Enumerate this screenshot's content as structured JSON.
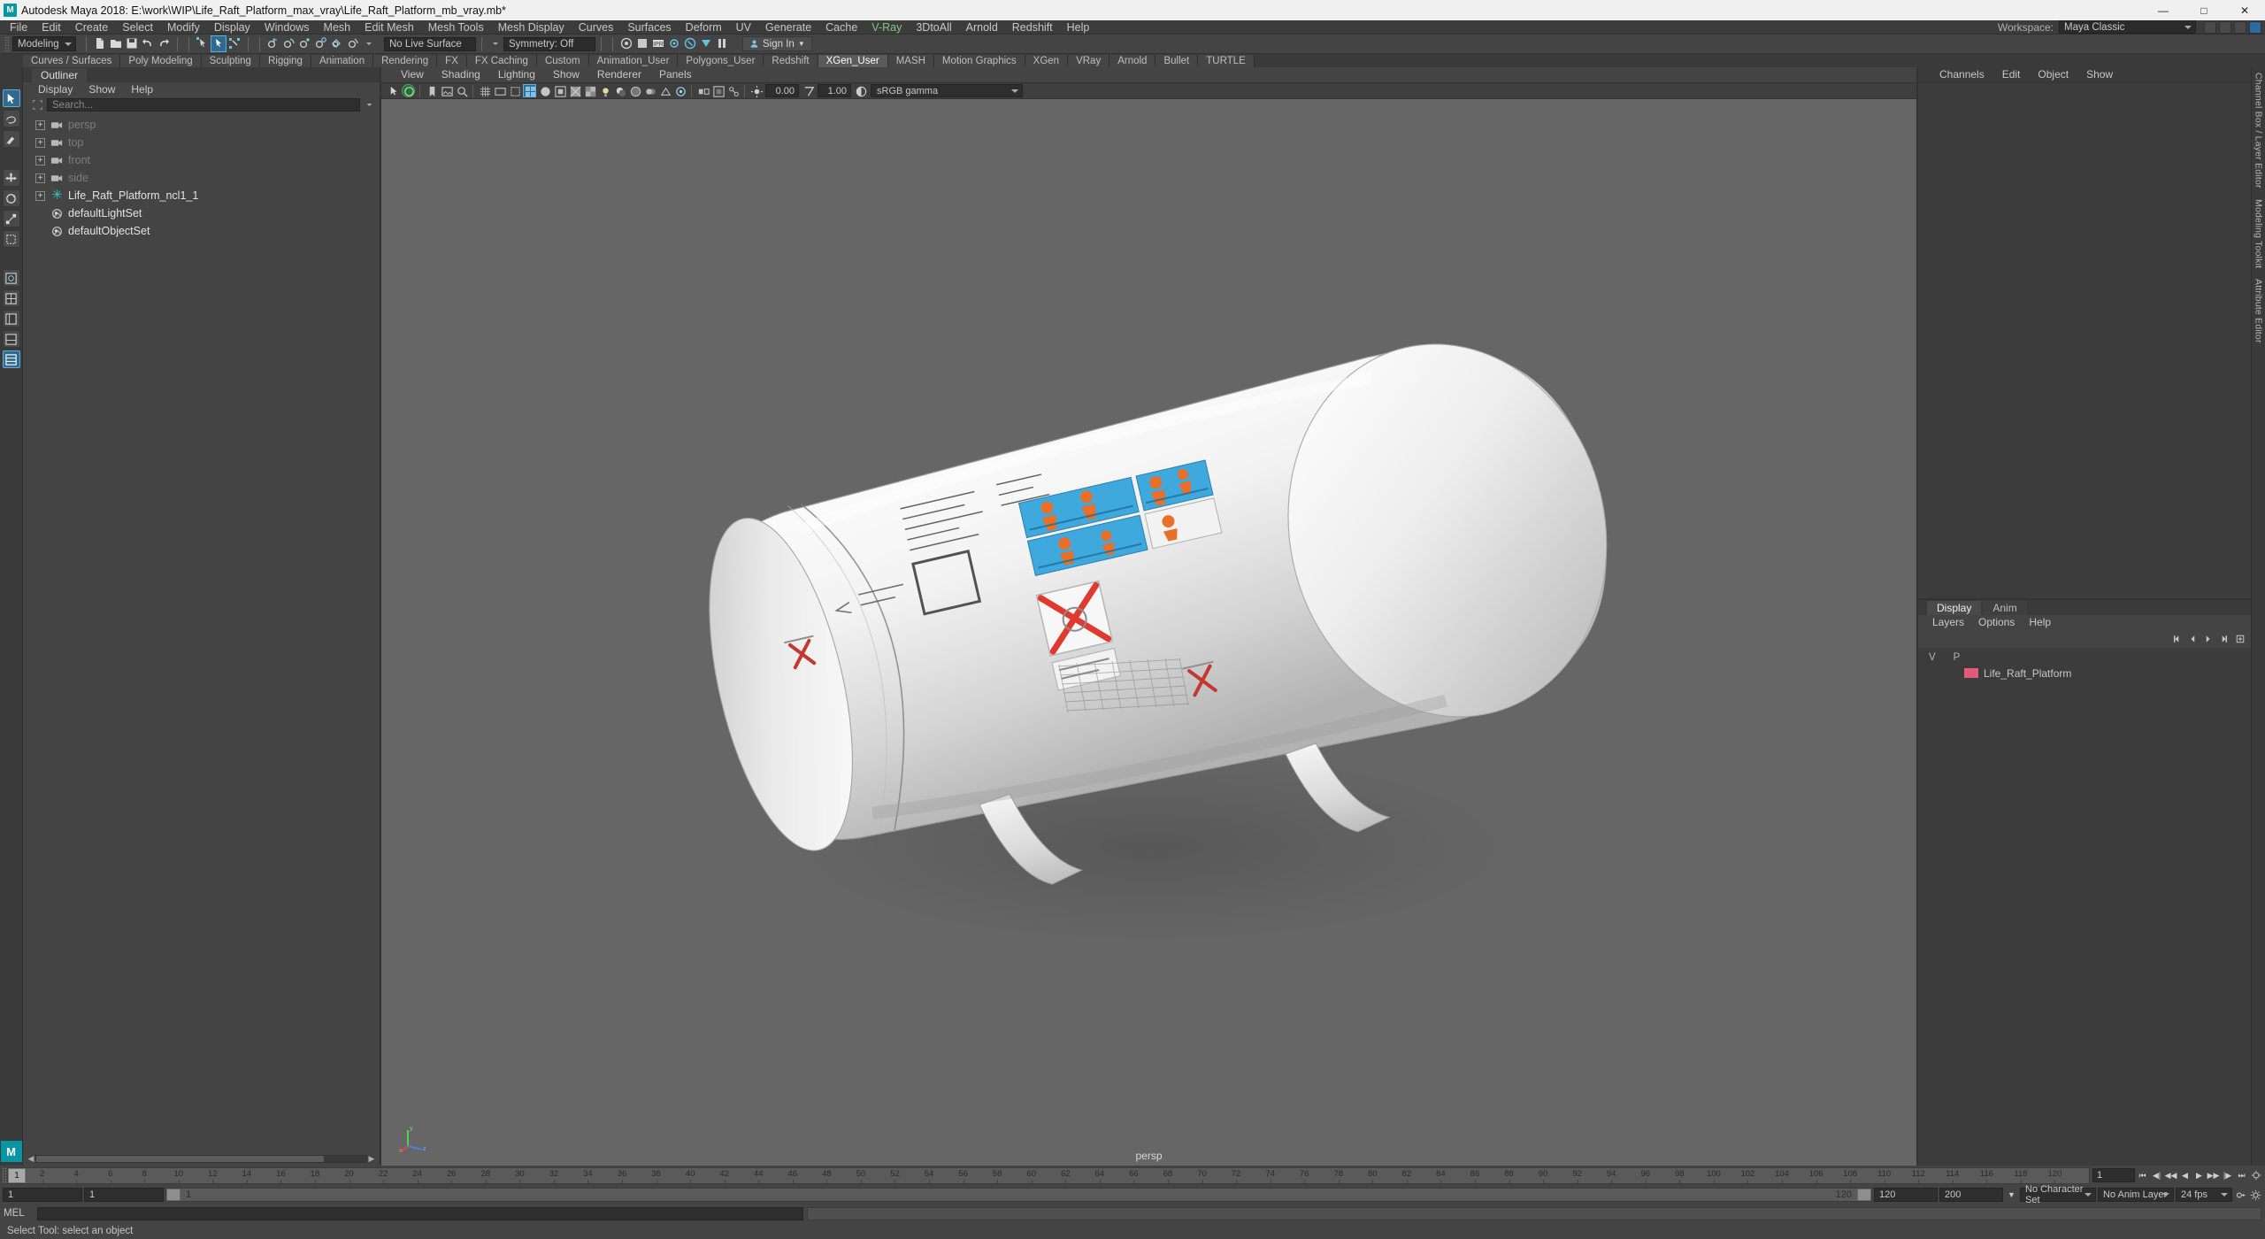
{
  "titlebar": {
    "app_title": "Autodesk Maya 2018: E:\\work\\WIP\\Life_Raft_Platform_max_vray\\Life_Raft_Platform_mb_vray.mb*",
    "logo": "M",
    "minimize": "—",
    "maximize": "□",
    "close": "✕"
  },
  "menubar": {
    "items": [
      "File",
      "Edit",
      "Create",
      "Select",
      "Modify",
      "Display",
      "Windows",
      "Mesh",
      "Edit Mesh",
      "Mesh Tools",
      "Mesh Display",
      "Curves",
      "Surfaces",
      "Deform",
      "UV",
      "Generate",
      "Cache",
      "V-Ray",
      "3DtoAll",
      "Arnold",
      "Redshift",
      "Help"
    ],
    "vray_item": "V-Ray",
    "workspace_label": "Workspace:",
    "workspace_value": "Maya Classic"
  },
  "statusbar": {
    "mode": "Modeling",
    "live_surface": "No Live Surface",
    "symmetry": "Symmetry: Off",
    "sign_in": "Sign In"
  },
  "shelf": {
    "tabs": [
      "Curves / Surfaces",
      "Poly Modeling",
      "Sculpting",
      "Rigging",
      "Animation",
      "Rendering",
      "FX",
      "FX Caching",
      "Custom",
      "Animation_User",
      "Polygons_User",
      "Redshift",
      "XGen_User",
      "MASH",
      "Motion Graphics",
      "XGen",
      "VRay",
      "Arnold",
      "Bullet",
      "TURTLE"
    ],
    "active_tab": "XGen_User"
  },
  "outliner": {
    "title": "Outliner",
    "menus": [
      "Display",
      "Show",
      "Help"
    ],
    "search_placeholder": "Search...",
    "items": [
      {
        "label": "persp",
        "icon": "camera-icon",
        "expandable": true,
        "dim": true
      },
      {
        "label": "top",
        "icon": "camera-icon",
        "expandable": true,
        "dim": true
      },
      {
        "label": "front",
        "icon": "camera-icon",
        "expandable": true,
        "dim": true
      },
      {
        "label": "side",
        "icon": "camera-icon",
        "expandable": true,
        "dim": true
      },
      {
        "label": "Life_Raft_Platform_ncl1_1",
        "icon": "mesh-star-icon",
        "expandable": true,
        "dim": false
      },
      {
        "label": "defaultLightSet",
        "icon": "set-icon",
        "expandable": false,
        "dim": false
      },
      {
        "label": "defaultObjectSet",
        "icon": "set-icon",
        "expandable": false,
        "dim": false
      }
    ]
  },
  "viewport": {
    "menus": [
      "View",
      "Shading",
      "Lighting",
      "Show",
      "Renderer",
      "Panels"
    ],
    "exposure": "0.00",
    "gamma": "1.00",
    "color_space": "sRGB gamma",
    "camera_label": "persp",
    "axis_labels": {
      "x": "x",
      "y": "y",
      "z": "z"
    }
  },
  "channelbox": {
    "tabs": [
      "Channels",
      "Edit",
      "Object",
      "Show"
    ]
  },
  "layers": {
    "tabs": [
      "Display",
      "Anim"
    ],
    "active_tab": "Display",
    "menus": [
      "Layers",
      "Options",
      "Help"
    ],
    "columns": [
      "V",
      "P"
    ],
    "rows": [
      {
        "v": "",
        "p": "",
        "color": "#e05a7a",
        "name": "Life_Raft_Platform"
      }
    ]
  },
  "dock": {
    "labels": [
      "Channel Box / Layer Editor",
      "Modeling Toolkit",
      "Attribute Editor"
    ]
  },
  "timeslider": {
    "current_frame": "1",
    "ticks": [
      "2",
      "4",
      "6",
      "8",
      "10",
      "12",
      "14",
      "16",
      "18",
      "20",
      "22",
      "24",
      "26",
      "28",
      "30",
      "32",
      "34",
      "36",
      "38",
      "40",
      "42",
      "44",
      "46",
      "48",
      "50",
      "52",
      "54",
      "56",
      "58",
      "60",
      "62",
      "64",
      "66",
      "68",
      "70",
      "72",
      "74",
      "76",
      "78",
      "80",
      "82",
      "84",
      "86",
      "88",
      "90",
      "92",
      "94",
      "96",
      "98",
      "100",
      "102",
      "104",
      "106",
      "108",
      "110",
      "112",
      "114",
      "116",
      "118",
      "120"
    ],
    "frame_field": "1",
    "playback_icons": [
      "⏮",
      "⏪",
      "◀◀",
      "◀",
      "▶",
      "▶▶",
      "⏩",
      "⏭"
    ]
  },
  "rangeslider": {
    "start": "1",
    "anim_start": "1",
    "range_start": "1",
    "range_end": "120",
    "anim_end": "120",
    "end": "200",
    "character_set": "No Character Set",
    "anim_layer": "No Anim Layer",
    "fps": "24 fps"
  },
  "commandline": {
    "label": "MEL",
    "input_value": "",
    "output_value": ""
  },
  "helpline": {
    "text": "Select Tool: select an object"
  },
  "colors": {
    "accent_teal": "#0696a5",
    "selection_blue": "#2f6b91",
    "panel_bg": "#444444",
    "viewport_bg": "#666666",
    "layer_color": "#e05a7a"
  }
}
